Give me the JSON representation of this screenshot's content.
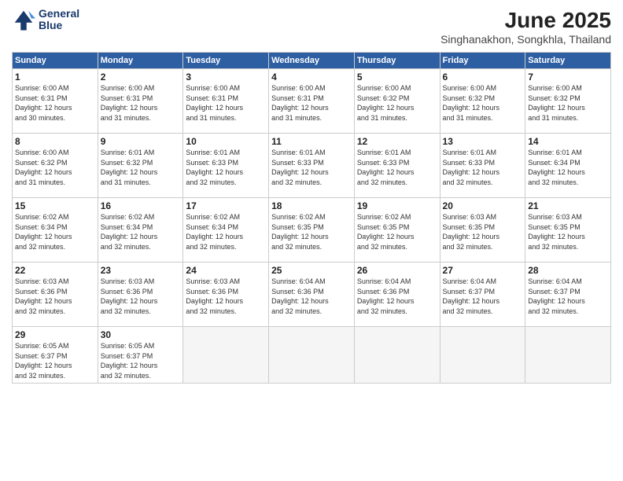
{
  "logo": {
    "line1": "General",
    "line2": "Blue"
  },
  "title": "June 2025",
  "location": "Singhanakhon, Songkhla, Thailand",
  "weekdays": [
    "Sunday",
    "Monday",
    "Tuesday",
    "Wednesday",
    "Thursday",
    "Friday",
    "Saturday"
  ],
  "weeks": [
    [
      {
        "day": "1",
        "lines": [
          "Sunrise: 6:00 AM",
          "Sunset: 6:31 PM",
          "Daylight: 12 hours",
          "and 30 minutes."
        ]
      },
      {
        "day": "2",
        "lines": [
          "Sunrise: 6:00 AM",
          "Sunset: 6:31 PM",
          "Daylight: 12 hours",
          "and 31 minutes."
        ]
      },
      {
        "day": "3",
        "lines": [
          "Sunrise: 6:00 AM",
          "Sunset: 6:31 PM",
          "Daylight: 12 hours",
          "and 31 minutes."
        ]
      },
      {
        "day": "4",
        "lines": [
          "Sunrise: 6:00 AM",
          "Sunset: 6:31 PM",
          "Daylight: 12 hours",
          "and 31 minutes."
        ]
      },
      {
        "day": "5",
        "lines": [
          "Sunrise: 6:00 AM",
          "Sunset: 6:32 PM",
          "Daylight: 12 hours",
          "and 31 minutes."
        ]
      },
      {
        "day": "6",
        "lines": [
          "Sunrise: 6:00 AM",
          "Sunset: 6:32 PM",
          "Daylight: 12 hours",
          "and 31 minutes."
        ]
      },
      {
        "day": "7",
        "lines": [
          "Sunrise: 6:00 AM",
          "Sunset: 6:32 PM",
          "Daylight: 12 hours",
          "and 31 minutes."
        ]
      }
    ],
    [
      {
        "day": "8",
        "lines": [
          "Sunrise: 6:00 AM",
          "Sunset: 6:32 PM",
          "Daylight: 12 hours",
          "and 31 minutes."
        ]
      },
      {
        "day": "9",
        "lines": [
          "Sunrise: 6:01 AM",
          "Sunset: 6:32 PM",
          "Daylight: 12 hours",
          "and 31 minutes."
        ]
      },
      {
        "day": "10",
        "lines": [
          "Sunrise: 6:01 AM",
          "Sunset: 6:33 PM",
          "Daylight: 12 hours",
          "and 32 minutes."
        ]
      },
      {
        "day": "11",
        "lines": [
          "Sunrise: 6:01 AM",
          "Sunset: 6:33 PM",
          "Daylight: 12 hours",
          "and 32 minutes."
        ]
      },
      {
        "day": "12",
        "lines": [
          "Sunrise: 6:01 AM",
          "Sunset: 6:33 PM",
          "Daylight: 12 hours",
          "and 32 minutes."
        ]
      },
      {
        "day": "13",
        "lines": [
          "Sunrise: 6:01 AM",
          "Sunset: 6:33 PM",
          "Daylight: 12 hours",
          "and 32 minutes."
        ]
      },
      {
        "day": "14",
        "lines": [
          "Sunrise: 6:01 AM",
          "Sunset: 6:34 PM",
          "Daylight: 12 hours",
          "and 32 minutes."
        ]
      }
    ],
    [
      {
        "day": "15",
        "lines": [
          "Sunrise: 6:02 AM",
          "Sunset: 6:34 PM",
          "Daylight: 12 hours",
          "and 32 minutes."
        ]
      },
      {
        "day": "16",
        "lines": [
          "Sunrise: 6:02 AM",
          "Sunset: 6:34 PM",
          "Daylight: 12 hours",
          "and 32 minutes."
        ]
      },
      {
        "day": "17",
        "lines": [
          "Sunrise: 6:02 AM",
          "Sunset: 6:34 PM",
          "Daylight: 12 hours",
          "and 32 minutes."
        ]
      },
      {
        "day": "18",
        "lines": [
          "Sunrise: 6:02 AM",
          "Sunset: 6:35 PM",
          "Daylight: 12 hours",
          "and 32 minutes."
        ]
      },
      {
        "day": "19",
        "lines": [
          "Sunrise: 6:02 AM",
          "Sunset: 6:35 PM",
          "Daylight: 12 hours",
          "and 32 minutes."
        ]
      },
      {
        "day": "20",
        "lines": [
          "Sunrise: 6:03 AM",
          "Sunset: 6:35 PM",
          "Daylight: 12 hours",
          "and 32 minutes."
        ]
      },
      {
        "day": "21",
        "lines": [
          "Sunrise: 6:03 AM",
          "Sunset: 6:35 PM",
          "Daylight: 12 hours",
          "and 32 minutes."
        ]
      }
    ],
    [
      {
        "day": "22",
        "lines": [
          "Sunrise: 6:03 AM",
          "Sunset: 6:36 PM",
          "Daylight: 12 hours",
          "and 32 minutes."
        ]
      },
      {
        "day": "23",
        "lines": [
          "Sunrise: 6:03 AM",
          "Sunset: 6:36 PM",
          "Daylight: 12 hours",
          "and 32 minutes."
        ]
      },
      {
        "day": "24",
        "lines": [
          "Sunrise: 6:03 AM",
          "Sunset: 6:36 PM",
          "Daylight: 12 hours",
          "and 32 minutes."
        ]
      },
      {
        "day": "25",
        "lines": [
          "Sunrise: 6:04 AM",
          "Sunset: 6:36 PM",
          "Daylight: 12 hours",
          "and 32 minutes."
        ]
      },
      {
        "day": "26",
        "lines": [
          "Sunrise: 6:04 AM",
          "Sunset: 6:36 PM",
          "Daylight: 12 hours",
          "and 32 minutes."
        ]
      },
      {
        "day": "27",
        "lines": [
          "Sunrise: 6:04 AM",
          "Sunset: 6:37 PM",
          "Daylight: 12 hours",
          "and 32 minutes."
        ]
      },
      {
        "day": "28",
        "lines": [
          "Sunrise: 6:04 AM",
          "Sunset: 6:37 PM",
          "Daylight: 12 hours",
          "and 32 minutes."
        ]
      }
    ],
    [
      {
        "day": "29",
        "lines": [
          "Sunrise: 6:05 AM",
          "Sunset: 6:37 PM",
          "Daylight: 12 hours",
          "and 32 minutes."
        ]
      },
      {
        "day": "30",
        "lines": [
          "Sunrise: 6:05 AM",
          "Sunset: 6:37 PM",
          "Daylight: 12 hours",
          "and 32 minutes."
        ]
      },
      null,
      null,
      null,
      null,
      null
    ]
  ]
}
